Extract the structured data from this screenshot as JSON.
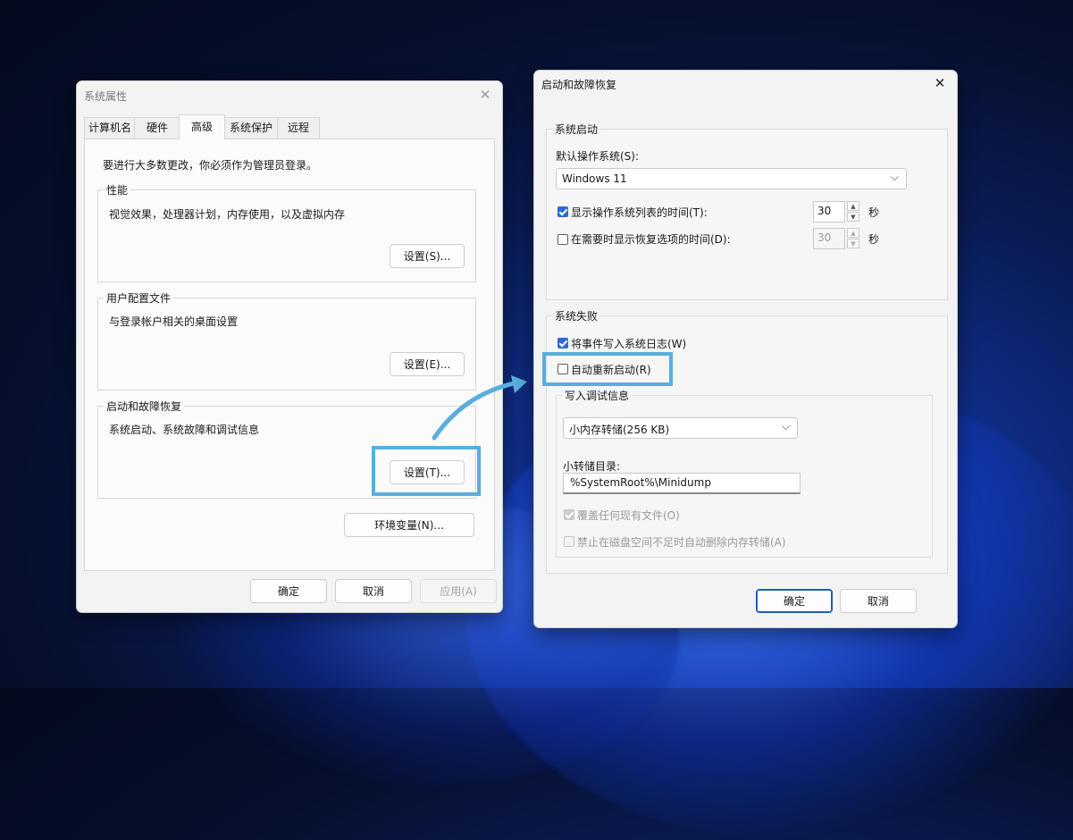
{
  "sysprops": {
    "title": "系统属性",
    "close_glyph": "✕",
    "tabs": [
      "计算机名",
      "硬件",
      "高级",
      "系统保护",
      "远程"
    ],
    "admin_note": "要进行大多数更改，你必须作为管理员登录。",
    "performance": {
      "label": "性能",
      "desc": "视觉效果，处理器计划，内存使用，以及虚拟内存",
      "button": "设置(S)..."
    },
    "profiles": {
      "label": "用户配置文件",
      "desc": "与登录帐户相关的桌面设置",
      "button": "设置(E)..."
    },
    "startup": {
      "label": "启动和故障恢复",
      "desc": "系统启动、系统故障和调试信息",
      "button": "设置(T)..."
    },
    "env_button": "环境变量(N)...",
    "ok": "确定",
    "cancel": "取消",
    "apply": "应用(A)"
  },
  "recovery": {
    "title": "启动和故障恢复",
    "close_glyph": "✕",
    "system_startup": {
      "label": "系统启动",
      "default_os_label": "默认操作系统(S):",
      "default_os_value": "Windows 11",
      "show_list_label": "显示操作系统列表的时间(T):",
      "show_list_checked": true,
      "show_list_value": "30",
      "show_recovery_label": "在需要时显示恢复选项的时间(D):",
      "show_recovery_checked": false,
      "show_recovery_value": "30",
      "unit": "秒"
    },
    "system_failure": {
      "label": "系统失败",
      "write_event_label": "将事件写入系统日志(W)",
      "write_event_checked": true,
      "auto_restart_label": "自动重新启动(R)",
      "auto_restart_checked": false,
      "debug_info_label": "写入调试信息",
      "dump_type": "小内存转储(256 KB)",
      "dump_dir_label": "小转储目录:",
      "dump_dir_value": "%SystemRoot%\\Minidump",
      "overwrite_label": "覆盖任何现有文件(O)",
      "overwrite_checked": true,
      "disable_autodelete_label": "禁止在磁盘空间不足时自动删除内存转储(A)",
      "disable_autodelete_checked": false
    },
    "ok": "确定",
    "cancel": "取消"
  },
  "colors": {
    "accent": "#2a6ad6",
    "highlight": "#5aaede",
    "desktop": "#0a1c55"
  },
  "icons": [
    "close-icon",
    "chevron-down-icon",
    "spin-up-icon",
    "spin-down-icon",
    "arrow-icon"
  ]
}
